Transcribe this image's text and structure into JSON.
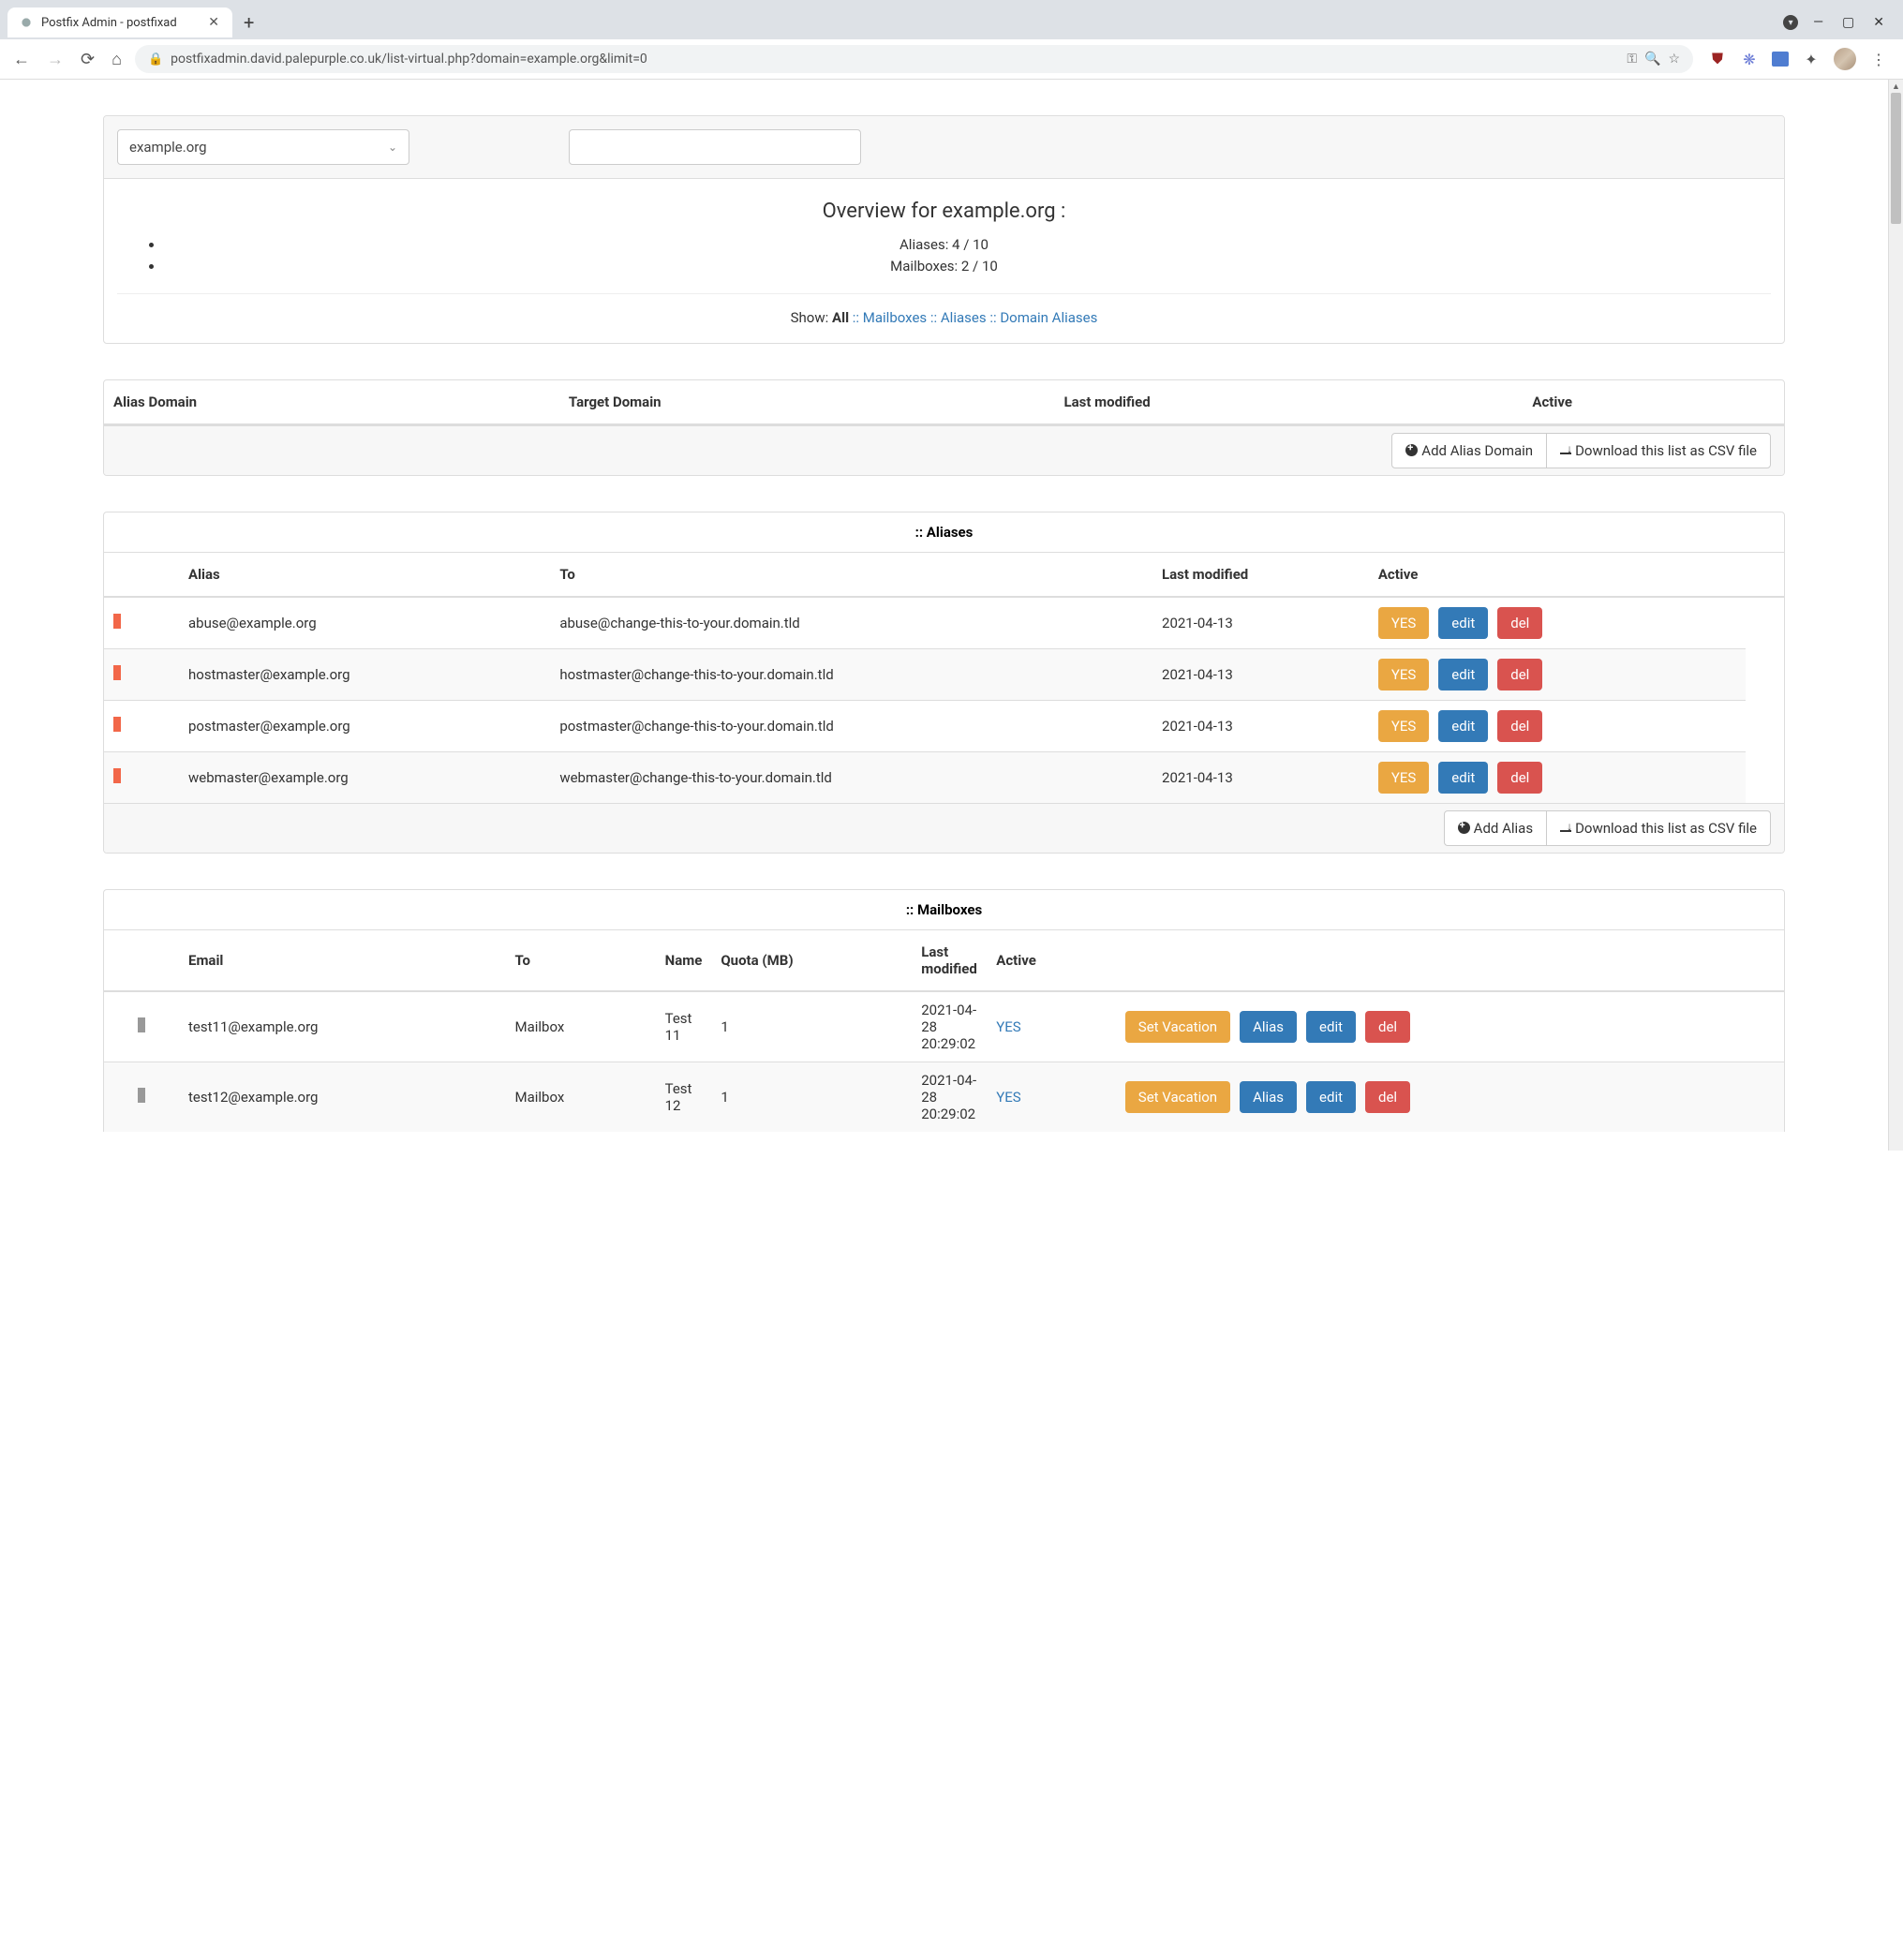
{
  "browser": {
    "tab_title": "Postfix Admin - postfixad",
    "url": "postfixadmin.david.palepurple.co.uk/list-virtual.php?domain=example.org&limit=0"
  },
  "domain_selector": {
    "selected": "example.org"
  },
  "overview": {
    "title": "Overview for example.org :",
    "aliases_stat": "Aliases: 4 / 10",
    "mailboxes_stat": "Mailboxes: 2 / 10"
  },
  "show_filter": {
    "label": "Show:",
    "all": "All",
    "mailboxes": "Mailboxes",
    "aliases": "Aliases",
    "domain_aliases": "Domain Aliases"
  },
  "alias_domain_table": {
    "headers": [
      "Alias Domain",
      "Target Domain",
      "Last modified",
      "Active"
    ],
    "add_btn": "Add Alias Domain",
    "csv_btn": "Download this list as CSV file"
  },
  "aliases_table": {
    "title": ":: Aliases",
    "headers": [
      "Alias",
      "To",
      "Last modified",
      "Active"
    ],
    "rows": [
      {
        "alias": "abuse@example.org",
        "to": "abuse@change-this-to-your.domain.tld",
        "modified": "2021-04-13",
        "active": "YES"
      },
      {
        "alias": "hostmaster@example.org",
        "to": "hostmaster@change-this-to-your.domain.tld",
        "modified": "2021-04-13",
        "active": "YES"
      },
      {
        "alias": "postmaster@example.org",
        "to": "postmaster@change-this-to-your.domain.tld",
        "modified": "2021-04-13",
        "active": "YES"
      },
      {
        "alias": "webmaster@example.org",
        "to": "webmaster@change-this-to-your.domain.tld",
        "modified": "2021-04-13",
        "active": "YES"
      }
    ],
    "add_btn": "Add Alias",
    "csv_btn": "Download this list as CSV file",
    "edit_label": "edit",
    "del_label": "del"
  },
  "mailboxes_table": {
    "title": ":: Mailboxes",
    "headers": [
      "Email",
      "To",
      "Name",
      "Quota (MB)",
      "Last modified",
      "Active"
    ],
    "rows": [
      {
        "email": "test11@example.org",
        "to": "Mailbox",
        "name": "Test 11",
        "quota": "1",
        "modified": "2021-04-28 20:29:02",
        "active": "YES"
      },
      {
        "email": "test12@example.org",
        "to": "Mailbox",
        "name": "Test 12",
        "quota": "1",
        "modified": "2021-04-28 20:29:02",
        "active": "YES"
      }
    ],
    "vacation_label": "Set Vacation",
    "alias_label": "Alias",
    "edit_label": "edit",
    "del_label": "del"
  }
}
